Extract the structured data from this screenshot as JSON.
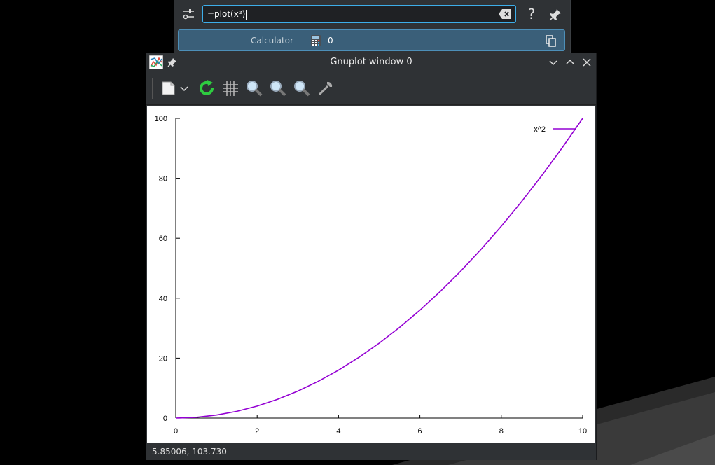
{
  "krunner": {
    "query": "=plot(x²)",
    "help_label": "?",
    "result": {
      "category": "Calculator",
      "value": "0"
    }
  },
  "window": {
    "title": "Gnuplot window 0",
    "status": "5.85006,  103.730"
  },
  "toolbar": {
    "tools": [
      "export-icon",
      "dropdown-icon",
      "replot-icon",
      "grid-icon",
      "zoom-previous-icon",
      "zoom-next-icon",
      "unzoom-icon",
      "settings-icon"
    ]
  },
  "colors": {
    "curve": "#9400d3",
    "accent": "#3daee9",
    "result_bg": "#3a5f79"
  },
  "chart_data": {
    "type": "line",
    "title": "",
    "xlabel": "",
    "ylabel": "",
    "xlim": [
      0,
      10
    ],
    "ylim": [
      0,
      100
    ],
    "xticks": [
      0,
      2,
      4,
      6,
      8,
      10
    ],
    "yticks": [
      0,
      20,
      40,
      60,
      80,
      100
    ],
    "xtick_labels": [
      "0",
      "2",
      "4",
      "6",
      "8",
      "10"
    ],
    "ytick_labels": [
      "0",
      "20",
      "40",
      "60",
      "80",
      "100"
    ],
    "legend_position": "top-right",
    "series": [
      {
        "name": "x^2",
        "color": "#9400d3",
        "x": [
          0,
          0.5,
          1,
          1.5,
          2,
          2.5,
          3,
          3.5,
          4,
          4.5,
          5,
          5.5,
          6,
          6.5,
          7,
          7.5,
          8,
          8.5,
          9,
          9.5,
          10
        ],
        "y": [
          0,
          0.25,
          1,
          2.25,
          4,
          6.25,
          9,
          12.25,
          16,
          20.25,
          25,
          30.25,
          36,
          42.25,
          49,
          56.25,
          64,
          72.25,
          81,
          90.25,
          100
        ]
      }
    ]
  }
}
